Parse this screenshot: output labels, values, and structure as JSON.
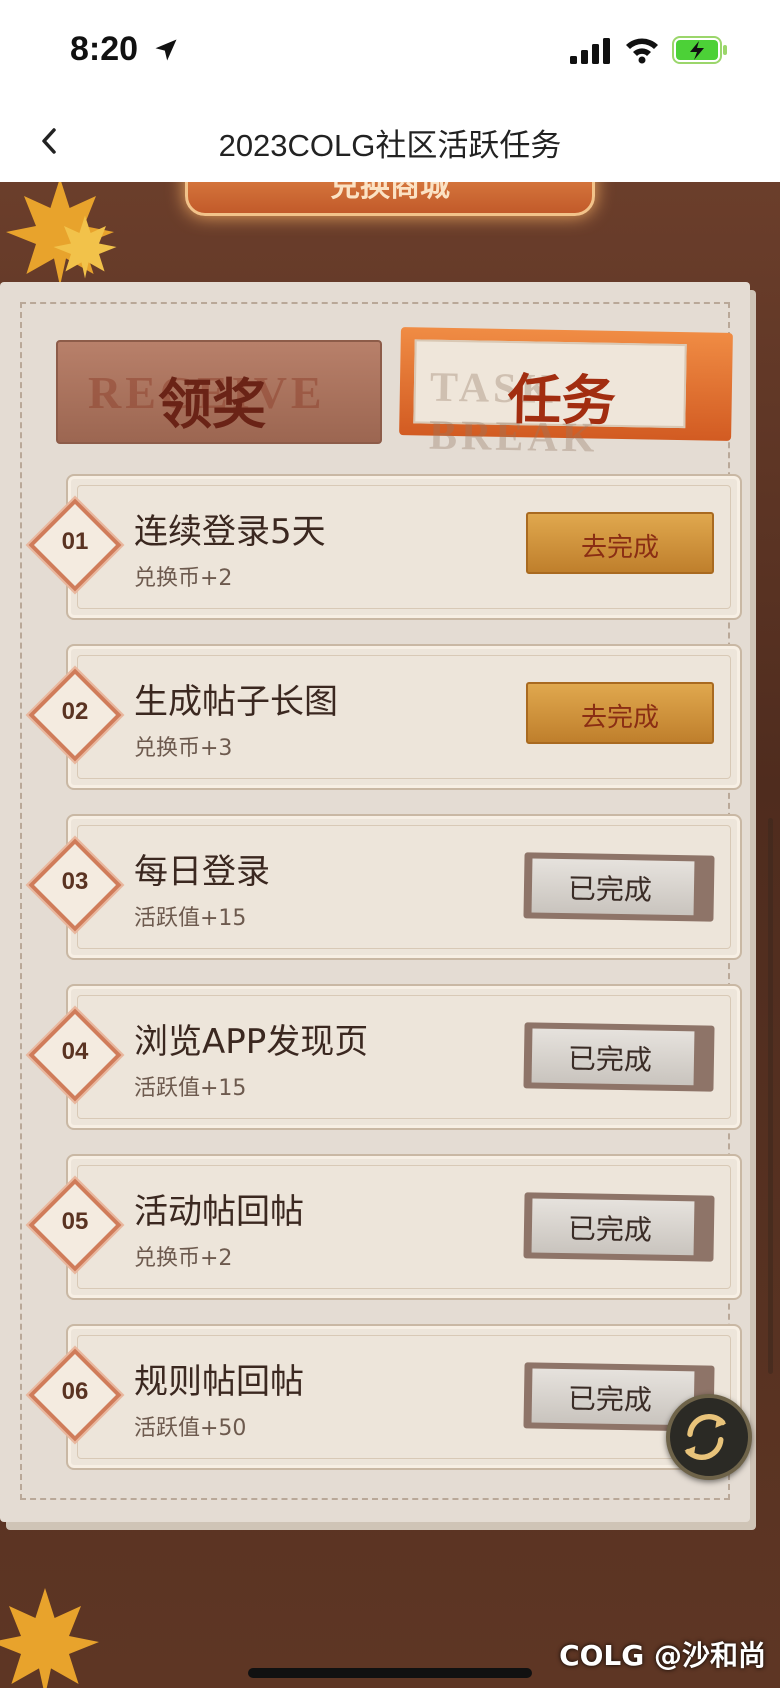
{
  "status_bar": {
    "time": "8:20"
  },
  "nav": {
    "title": "2023COLG社区活跃任务"
  },
  "banner": {
    "label": "兑换商城"
  },
  "tabs": {
    "claim": {
      "label": "领奖",
      "ghost": "RECEIVE"
    },
    "task": {
      "label": "任务",
      "ghost": "TASK BREAK"
    }
  },
  "tasks": [
    {
      "num": "01",
      "title": "连续登录5天",
      "reward": "兑换币+2",
      "button": "去完成",
      "state": "todo"
    },
    {
      "num": "02",
      "title": "生成帖子长图",
      "reward": "兑换币+3",
      "button": "去完成",
      "state": "todo"
    },
    {
      "num": "03",
      "title": "每日登录",
      "reward": "活跃值+15",
      "button": "已完成",
      "state": "done"
    },
    {
      "num": "04",
      "title": "浏览APP发现页",
      "reward": "活跃值+15",
      "button": "已完成",
      "state": "done"
    },
    {
      "num": "05",
      "title": "活动帖回帖",
      "reward": "兑换币+2",
      "button": "已完成",
      "state": "done"
    },
    {
      "num": "06",
      "title": "规则帖回帖",
      "reward": "活跃值+50",
      "button": "已完成",
      "state": "done"
    }
  ],
  "watermark": "COLG @沙和尚",
  "colors": {
    "accent": "#d25b22",
    "wood": "#5a3424",
    "paper": "#e4dcd3"
  },
  "icons": [
    "back-arrow-icon",
    "location-arrow-icon",
    "signal-icon",
    "wifi-icon",
    "battery-charging-icon",
    "refresh-icon",
    "maple-leaf-icon"
  ]
}
